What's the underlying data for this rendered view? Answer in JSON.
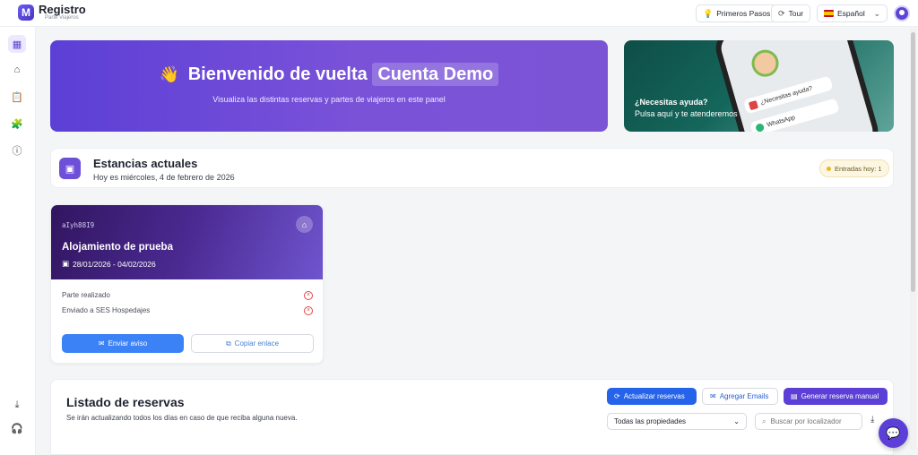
{
  "app": {
    "brand": "Registro",
    "brand_sub": "Parte Viajeros",
    "logo_letter": "M"
  },
  "topbar": {
    "primeros_pasos": "Primeros Pasos",
    "tour": "Tour",
    "language": "Español"
  },
  "welcome": {
    "title": "Bienvenido de vuelta",
    "user_name": "Cuenta Demo",
    "subtitle": "Visualiza las distintas reservas y partes de viajeros en este panel"
  },
  "help": {
    "title": "¿Necesitas ayuda?",
    "subtitle": "Pulsa aquí y te atenderemos",
    "phone_bubble": "¿Necesitas ayuda?",
    "phone_whatsapp": "WhatsApp"
  },
  "estancias": {
    "title": "Estancias actuales",
    "date": "Hoy es miércoles, 4 de febrero de 2026",
    "badge": "Entradas hoy: 1"
  },
  "property": {
    "code": "aIyh88I9",
    "name": "Alojamiento de prueba",
    "range": "28/01/2026 - 04/02/2026",
    "status_rows": [
      {
        "label": "Parte realizado"
      },
      {
        "label": "Enviado a SES Hospedajes"
      }
    ],
    "btn_send": "Enviar aviso",
    "btn_copy": "Copiar enlace"
  },
  "listado": {
    "title": "Listado de reservas",
    "subtitle": "Se irán actualizando todos los días en caso de que reciba alguna nueva.",
    "btn_update": "Actualizar reservas",
    "btn_emails": "Agregar Emails",
    "btn_manual": "Generar reserva manual",
    "select_value": "Todas las propiedades",
    "search_placeholder": "Buscar por localizador"
  },
  "colors": {
    "accent": "#5b3fd6",
    "primary_blue": "#2563eb",
    "error": "#e04848"
  }
}
